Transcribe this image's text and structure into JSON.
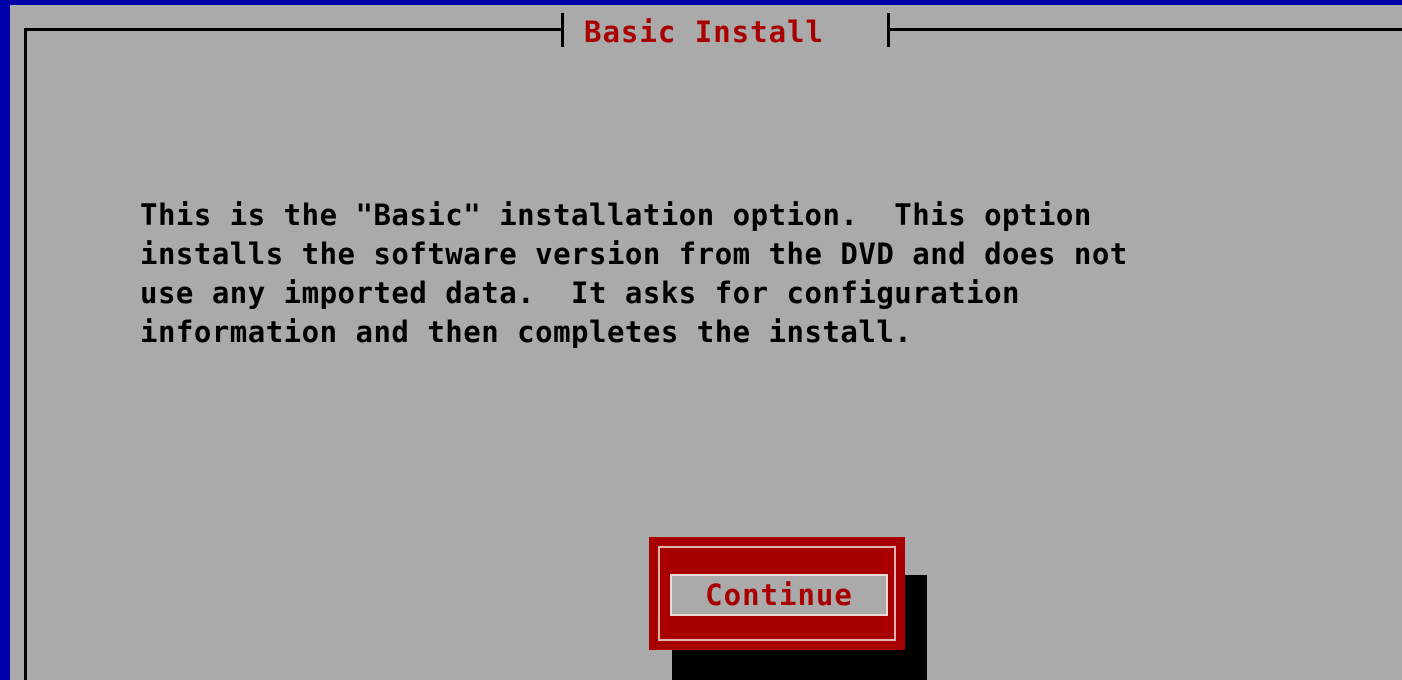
{
  "dialog": {
    "title": "Basic Install",
    "body_lines": [
      "This is the \"Basic\" installation option.  This option",
      "installs the software version from the DVD and does not",
      "use any imported data.  It asks for configuration",
      "information and then completes the install."
    ],
    "continue_label": "Continue"
  },
  "colors": {
    "screen_background": "#0000a8",
    "dialog_background": "#aaaaaa",
    "title_text": "#a80000",
    "body_text": "#000000",
    "button_focus": "#a80000",
    "shadow": "#000000"
  }
}
